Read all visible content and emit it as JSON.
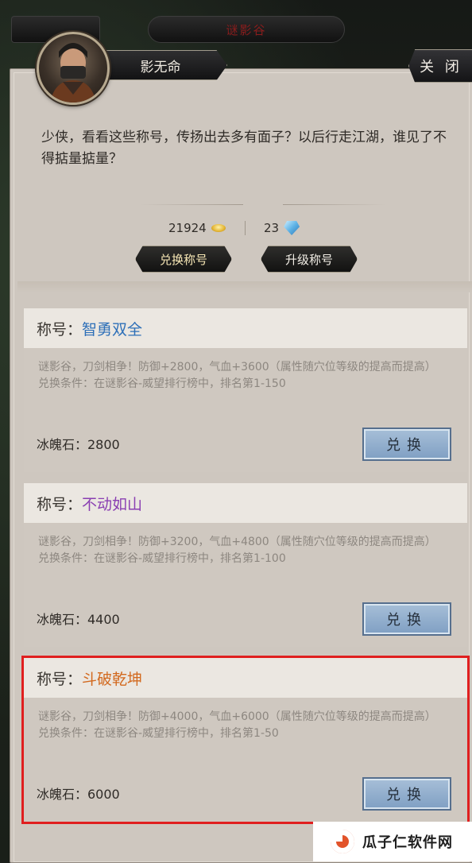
{
  "top_tabs": {
    "center_label": "谜影谷"
  },
  "npc": {
    "name": "影无命",
    "avatar_icon": "masked-warrior-portrait"
  },
  "close_label": "关 闭",
  "dialog": "少侠，看看这些称号，传扬出去多有面子？以后行走江湖，谁见了不得掂量掂量？",
  "currency": {
    "gold": "21924",
    "gold_icon": "gold-ingot-icon",
    "gems": "23",
    "gem_icon": "ice-crystal-icon"
  },
  "tabs": {
    "exchange": "兑换称号",
    "upgrade": "升级称号"
  },
  "title_prefix": "称号：",
  "cards": [
    {
      "title": "智勇双全",
      "title_color": "#2d6fb8",
      "desc_line1": "谜影谷，刀剑相争！防御+2800，气血+3600（属性随穴位等级的提高而提高）",
      "desc_line2": "兑换条件：在谜影谷-威望排行榜中，排名第1-150",
      "cost": "冰魄石：2800",
      "button": "兑换"
    },
    {
      "title": "不动如山",
      "title_color": "#8a3fb2",
      "desc_line1": "谜影谷，刀剑相争！防御+3200，气血+4800（属性随穴位等级的提高而提高）",
      "desc_line2": "兑换条件：在谜影谷-威望排行榜中，排名第1-100",
      "cost": "冰魄石：4400",
      "button": "兑换"
    },
    {
      "title": "斗破乾坤",
      "title_color": "#d2691e",
      "desc_line1": "谜影谷，刀剑相争！防御+4000，气血+6000（属性随穴位等级的提高而提高）",
      "desc_line2": "兑换条件：在谜影谷-威望排行榜中，排名第1-50",
      "cost": "冰魄石：6000",
      "button": "兑换"
    }
  ],
  "watermark": "瓜子仁软件网"
}
